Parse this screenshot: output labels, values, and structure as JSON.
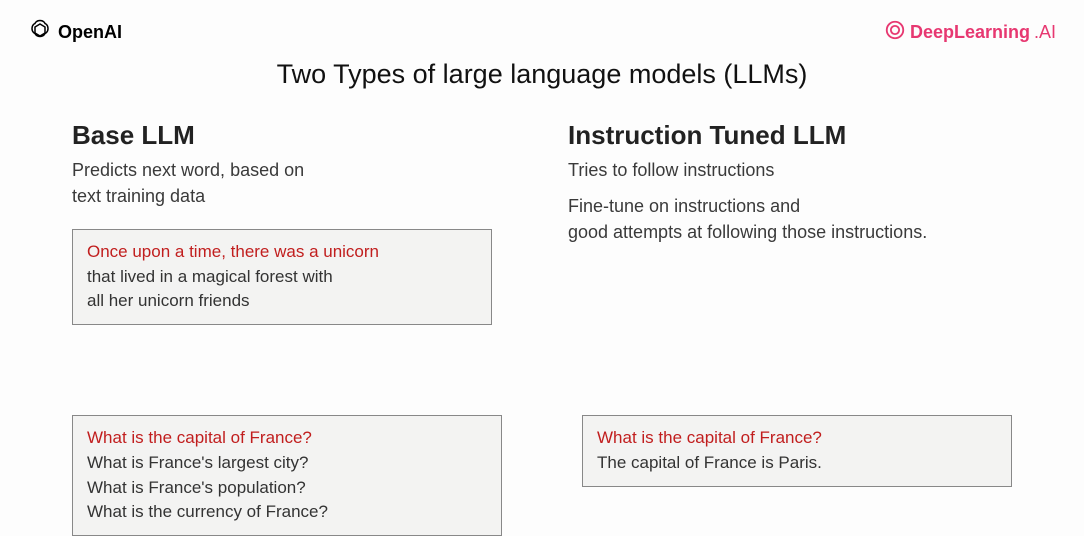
{
  "header": {
    "left_logo_text": "OpenAI",
    "right_logo_text_1": "DeepLearning",
    "right_logo_text_2": ".AI"
  },
  "title": "Two Types of large language models (LLMs)",
  "left": {
    "heading": "Base LLM",
    "desc1": "Predicts next word, based on",
    "desc2": "text training data",
    "box1_prompt": "Once upon a time, there was a unicorn",
    "box1_line1": "that lived in a magical forest with",
    "box1_line2": "all her unicorn friends",
    "box2_prompt": "What is the capital of France?",
    "box2_line1": "What is France's largest city?",
    "box2_line2": "What is France's population?",
    "box2_line3": "What is the currency of France?"
  },
  "right": {
    "heading": "Instruction Tuned LLM",
    "desc1": "Tries to follow instructions",
    "desc2": "Fine-tune on instructions and",
    "desc3": "good attempts at following those instructions.",
    "box_prompt": "What is the capital of France?",
    "box_line1": "The capital of France is Paris."
  }
}
